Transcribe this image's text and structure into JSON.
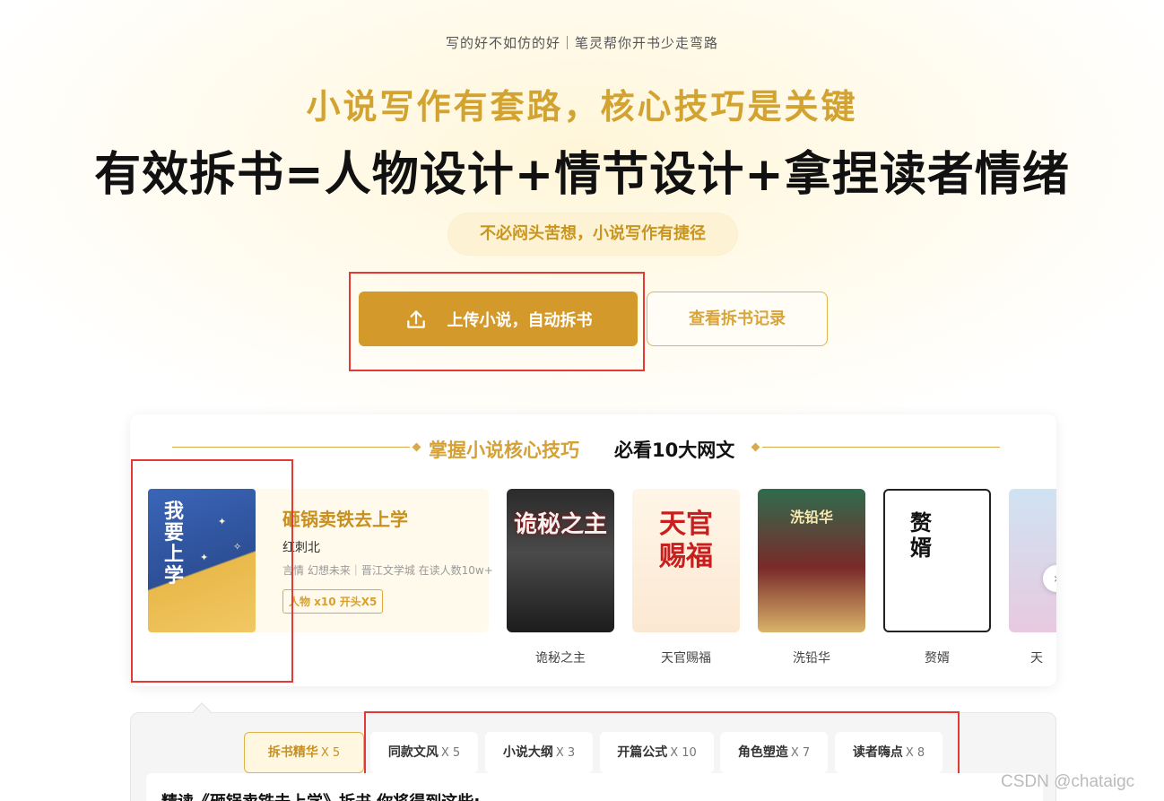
{
  "header": {
    "tagline": "写的好不如仿的好｜笔灵帮你开书少走弯路",
    "headline_gold": "小说写作有套路，核心技巧是关键",
    "headline_main": "有效拆书=人物设计+情节设计+拿捏读者情绪",
    "pill": "不必闷头苦想，小说写作有捷径"
  },
  "actions": {
    "upload_label": "上传小说，自动拆书",
    "records_label": "查看拆书记录"
  },
  "section": {
    "title": "掌握小说核心技巧",
    "subtitle": "必看10大网文"
  },
  "featured": {
    "cover_text": "我要上学",
    "title": "砸锅卖铁去上学",
    "author": "红刺北",
    "meta": "言情 幻想未来｜晋江文学城 在读人数10w+",
    "tag": "人物 x10 开头X5"
  },
  "books": [
    {
      "name": "诡秘之主",
      "cover_text": "诡秘之主"
    },
    {
      "name": "天官赐福",
      "cover_text": "天官赐福"
    },
    {
      "name": "洗铅华",
      "cover_text": "洗铅华"
    },
    {
      "name": "赘婿",
      "cover_text": "赘婿"
    },
    {
      "name": "天",
      "cover_text": ""
    }
  ],
  "tabs": [
    {
      "label": "拆书精华",
      "count": "X 5"
    },
    {
      "label": "同款文风",
      "count": "X 5"
    },
    {
      "label": "小说大纲",
      "count": "X 3"
    },
    {
      "label": "开篇公式",
      "count": "X 10"
    },
    {
      "label": "角色塑造",
      "count": "X 7"
    },
    {
      "label": "读者嗨点",
      "count": "X 8"
    }
  ],
  "body_text": "精读《砸锅卖铁去上学》拆书 你将得到这些:",
  "watermark": "CSDN @chataigc",
  "colors": {
    "gold": "#d4992b",
    "gold_text": "#d3a331",
    "annotation_red": "#e53935"
  },
  "icons": {
    "upload": "upload-icon",
    "next": "chevron-right-icon"
  }
}
